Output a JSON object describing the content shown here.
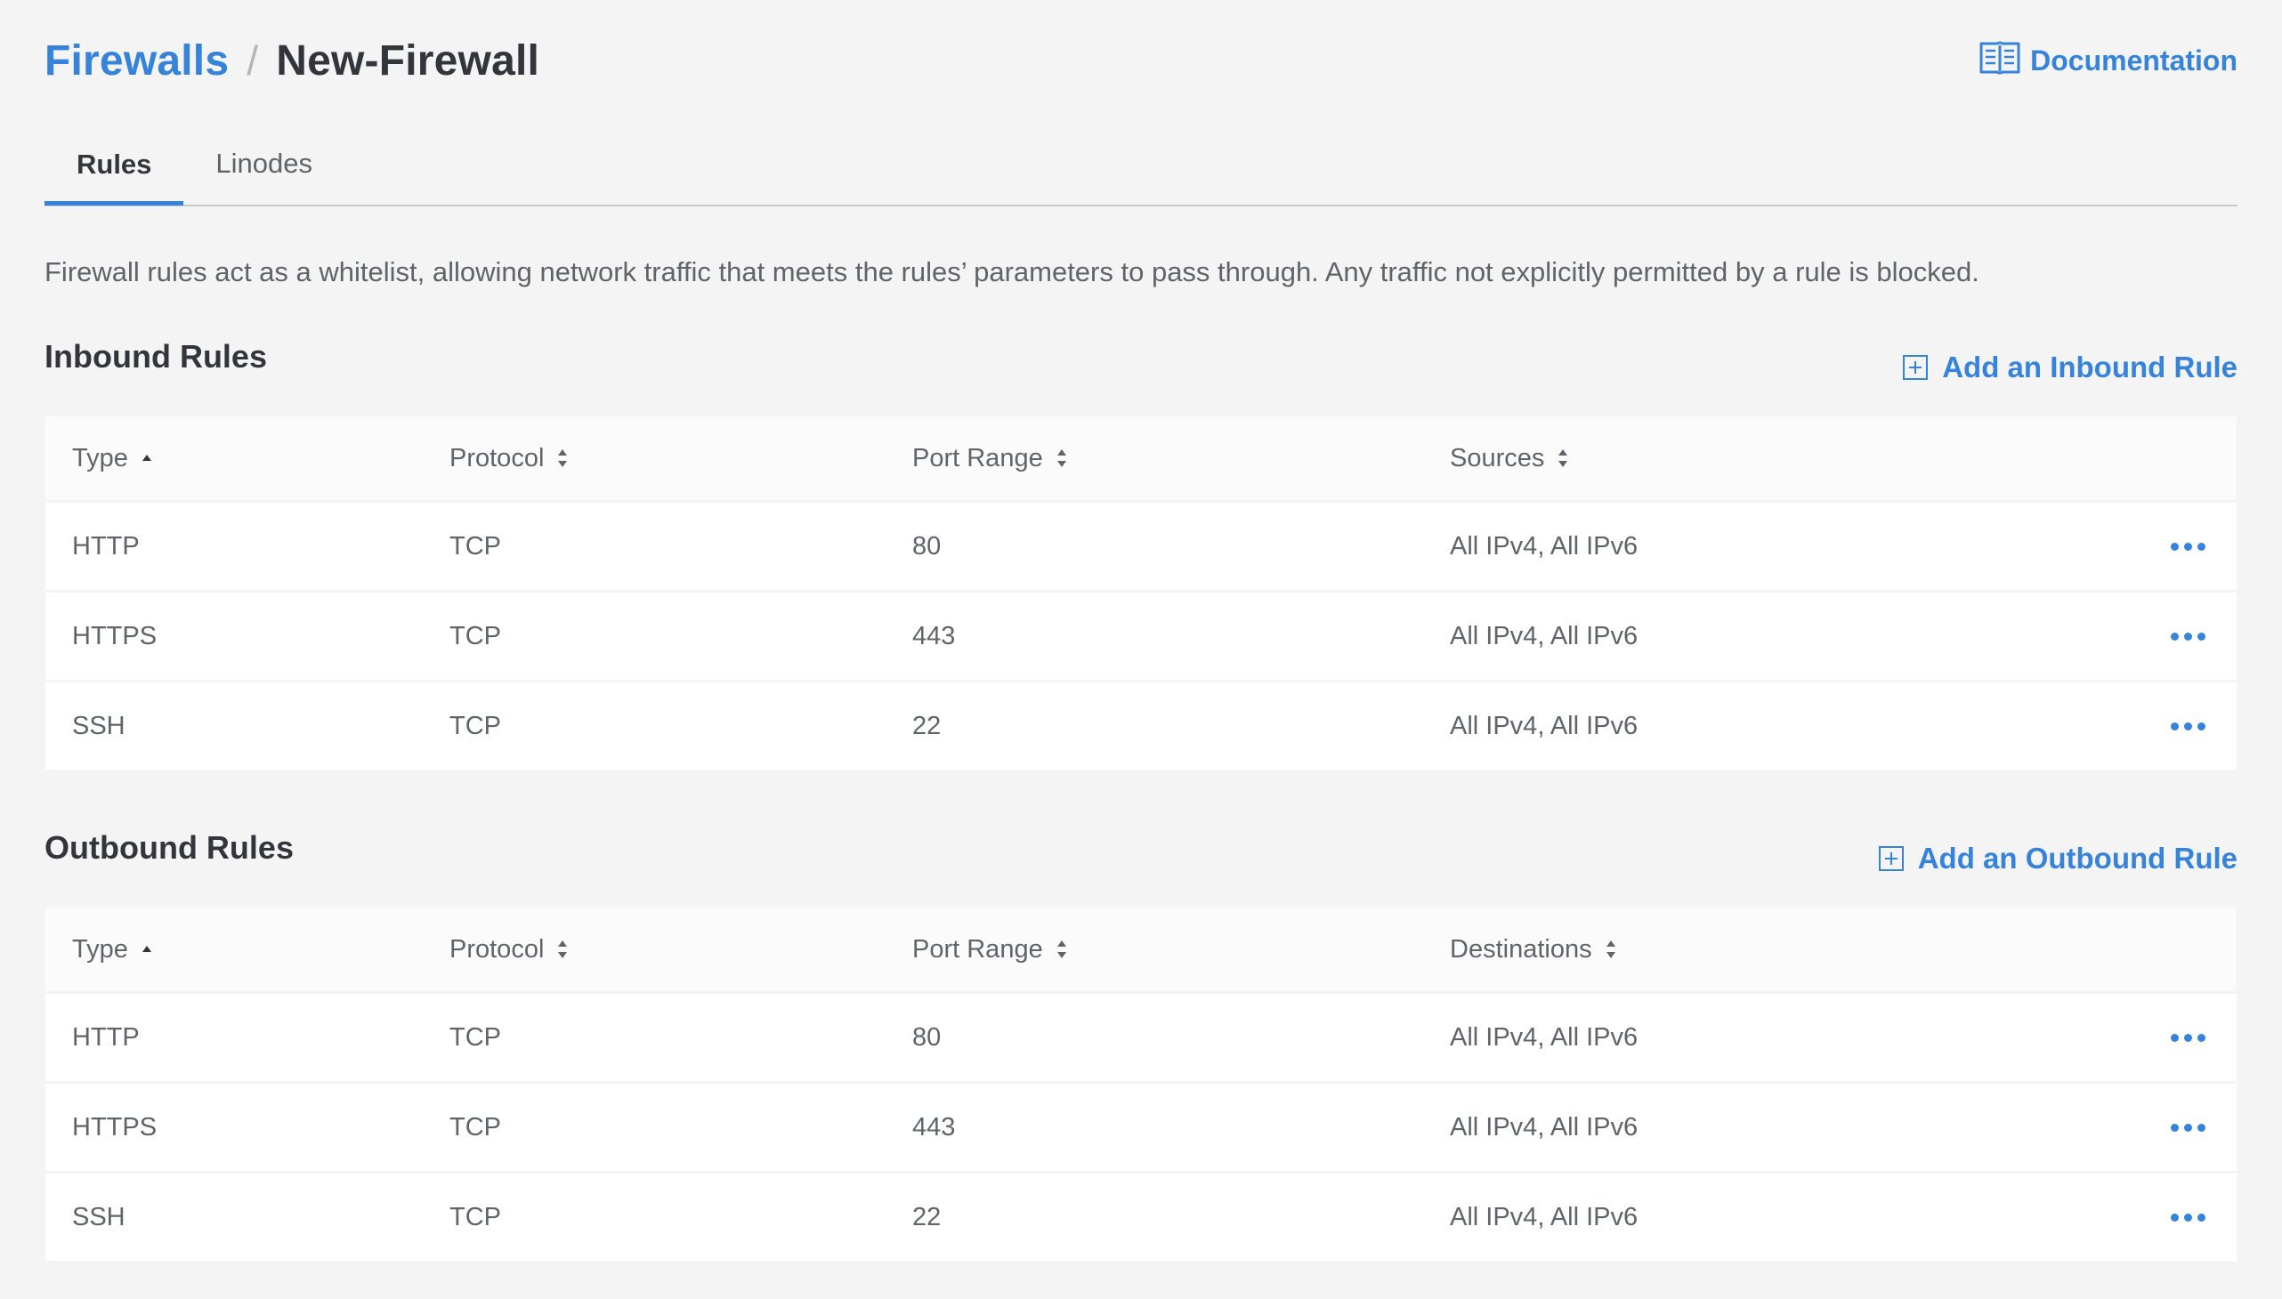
{
  "breadcrumb": {
    "parent": "Firewalls",
    "separator": "/",
    "current": "New-Firewall"
  },
  "documentation": {
    "label": "Documentation",
    "icon": "book-icon"
  },
  "tabs": [
    {
      "label": "Rules",
      "active": true
    },
    {
      "label": "Linodes",
      "active": false
    }
  ],
  "description": "Firewall rules act as a whitelist, allowing network traffic that meets the rules’ parameters to pass through. Any traffic not explicitly permitted by a rule is blocked.",
  "inbound": {
    "title": "Inbound Rules",
    "add_label": "Add an Inbound Rule",
    "columns": [
      "Type",
      "Protocol",
      "Port Range",
      "Sources"
    ],
    "rows": [
      {
        "type": "HTTP",
        "protocol": "TCP",
        "ports": "80",
        "addresses": "All IPv4, All IPv6"
      },
      {
        "type": "HTTPS",
        "protocol": "TCP",
        "ports": "443",
        "addresses": "All IPv4, All IPv6"
      },
      {
        "type": "SSH",
        "protocol": "TCP",
        "ports": "22",
        "addresses": "All IPv4, All IPv6"
      }
    ]
  },
  "outbound": {
    "title": "Outbound Rules",
    "add_label": "Add an Outbound Rule",
    "columns": [
      "Type",
      "Protocol",
      "Port Range",
      "Destinations"
    ],
    "rows": [
      {
        "type": "HTTP",
        "protocol": "TCP",
        "ports": "80",
        "addresses": "All IPv4, All IPv6"
      },
      {
        "type": "HTTPS",
        "protocol": "TCP",
        "ports": "443",
        "addresses": "All IPv4, All IPv6"
      },
      {
        "type": "SSH",
        "protocol": "TCP",
        "ports": "22",
        "addresses": "All IPv4, All IPv6"
      }
    ]
  },
  "colors": {
    "accent": "#3683dc",
    "background": "#f4f4f4",
    "text": "#32363c",
    "muted": "#606469"
  }
}
